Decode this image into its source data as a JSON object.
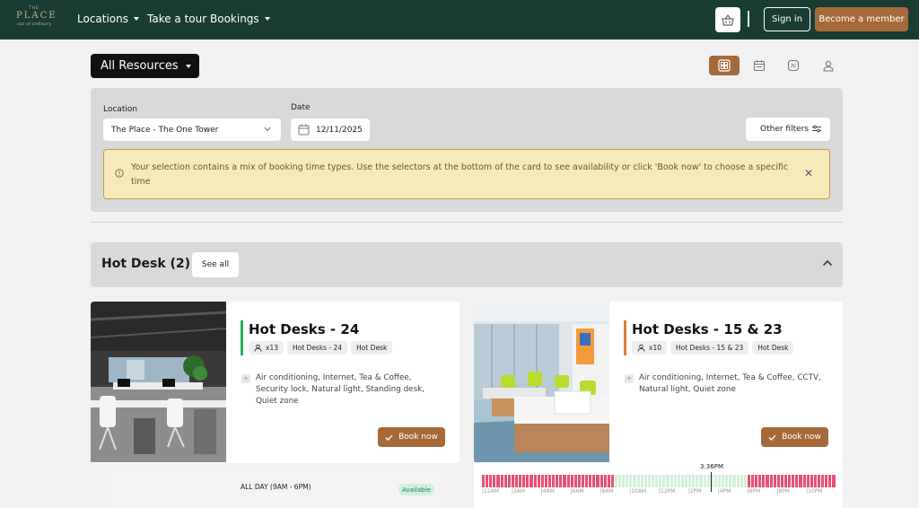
{
  "nav": {
    "logo": {
      "small": "THE",
      "big": "PLACE",
      "script": "out of ordinary"
    },
    "links": [
      {
        "label": "Locations",
        "dropdown": true
      },
      {
        "label": "Take a tour",
        "dropdown": false
      },
      {
        "label": "Bookings",
        "dropdown": true
      }
    ],
    "basket_icon": "basket-icon",
    "sign_in": "Sign in",
    "become_member": "Become a member"
  },
  "toolbar": {
    "resource_select": "All Resources",
    "views": [
      "grid-view-icon",
      "calendar-view-icon",
      "floorplan-view-icon",
      "person-view-icon"
    ],
    "active_view": 0
  },
  "filters": {
    "location_label": "Location",
    "location_value": "The Place - The One Tower",
    "date_label": "Date",
    "date_value": "12/11/2025",
    "other_filters": "Other filters",
    "alert": "Your selection contains a mix of booking time types. Use the selectors at the bottom of the card to see availability or click 'Book now' to choose a specific time"
  },
  "section": {
    "title": "Hot Desk (2)",
    "see_all": "See all"
  },
  "cards": [
    {
      "title": "Hot Desks - 24",
      "accent": "#2eaa5c",
      "capacity": "x13",
      "tags": [
        "Hot Desks - 24",
        "Hot Desk"
      ],
      "amenities": "Air conditioning, Internet, Tea & Coffee, Security lock, Natural light, Standing desk, Quiet zone",
      "book": "Book now"
    },
    {
      "title": "Hot Desks - 15 & 23",
      "accent": "#e07a3c",
      "capacity": "x10",
      "tags": [
        "Hot Desks - 15 & 23",
        "Hot Desk"
      ],
      "amenities": "Air conditioning, Internet, Tea & Coffee, CCTV, Natural light, Quiet zone",
      "book": "Book now"
    }
  ],
  "availability": {
    "label": "ALL DAY (9AM - 6PM)",
    "status": "Available"
  },
  "timeline": {
    "now": "3:36PM",
    "ticks": [
      "12AM",
      "2AM",
      "4AM",
      "6AM",
      "8AM",
      "10AM",
      "12PM",
      "2PM",
      "4PM",
      "6PM",
      "8PM",
      "10PM"
    ],
    "slots": "RRRRRRRRRRRRRRRRRRRRRRRRRRRRRRRRRRRRGGGGGGGGGGGGGGGGGGGGGGGGGGGGGGGGGGGGRRRRRRRRRRRRRRRRRRRRRRRR",
    "colors": {
      "booked": "#e9506f",
      "free": "#d4efdd"
    }
  }
}
